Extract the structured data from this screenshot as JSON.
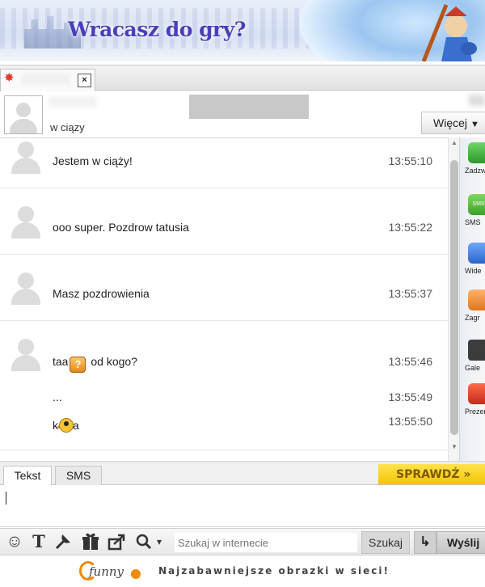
{
  "banner": {
    "title": "Wracasz do gry?"
  },
  "tab": {
    "status_icon": "✸",
    "close_label": "×"
  },
  "contact": {
    "status": "w ciązy",
    "more_label": "Więcej",
    "more_arrow": "▼"
  },
  "messages": [
    {
      "text": "Jestem w ciąży!",
      "time": "13:55:10"
    },
    {
      "text": "ooo super. Pozdrow tatusia",
      "time": "13:55:22"
    },
    {
      "text": "Masz pozdrowienia",
      "time": "13:55:37"
    },
    {
      "lines": [
        {
          "text_before": "taa",
          "emoticon": "question-emoticon",
          "emoticon_glyph": "?",
          "text_after": "od kogo?",
          "time": "13:55:46"
        },
        {
          "text": "...",
          "time": "13:55:49"
        },
        {
          "text_before": "k",
          "emoticon": "bird-emoticon",
          "text_after": "a",
          "time": "13:55:50"
        }
      ]
    }
  ],
  "actions": [
    {
      "label": "Zadzw",
      "icon": "phone-icon"
    },
    {
      "label": "SMS",
      "icon": "sms-icon",
      "glyph": "SMS"
    },
    {
      "label": "Wide",
      "icon": "video-icon"
    },
    {
      "label": "Zagr",
      "icon": "game-icon"
    },
    {
      "label": "Gale",
      "icon": "camera-icon"
    },
    {
      "label": "Prezen",
      "icon": "gift-icon"
    }
  ],
  "input_tabs": {
    "text_tab": "Tekst",
    "sms_tab": "SMS",
    "check_button": "SPRAWDŹ »"
  },
  "toolbar": {
    "emoticon_glyph": "☺",
    "text_glyph": "T",
    "search_dropdown": "▾",
    "search_placeholder": "Szukaj w internecie",
    "search_button": "Szukaj",
    "enter_glyph": "↳",
    "send_button": "Wyślij"
  },
  "footer": {
    "logo_text": "funny",
    "tagline": "Najzabawniejsze obrazki w sieci!"
  },
  "colors": {
    "banner_title": "#4a3fb8",
    "check_button": "#f4c400",
    "logo_accent": "#f08a00"
  }
}
